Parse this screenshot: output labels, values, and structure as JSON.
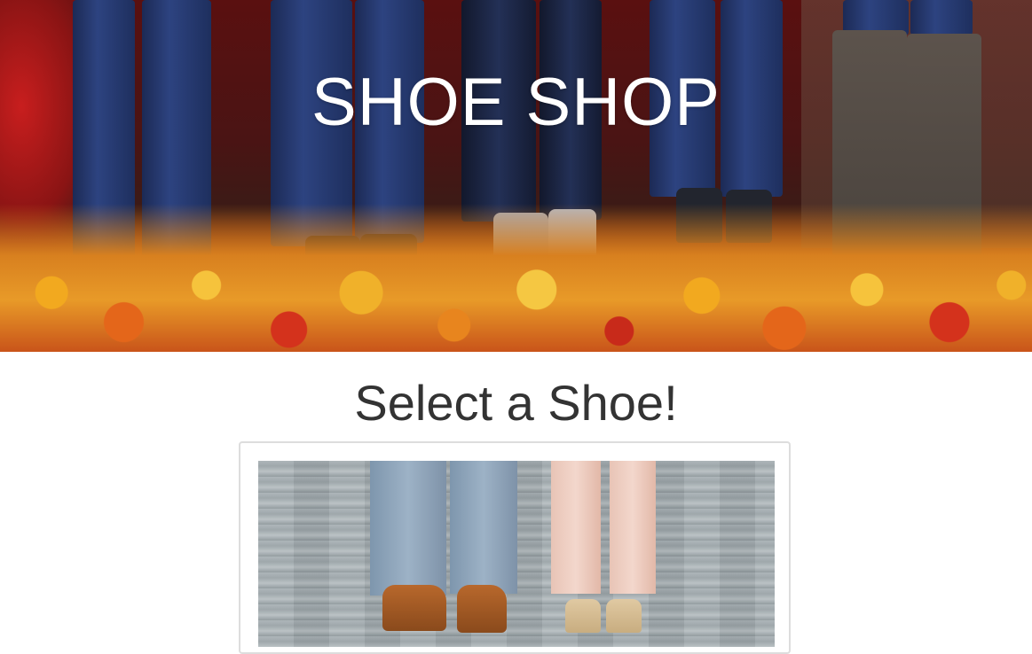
{
  "hero": {
    "title": "SHOE SHOP",
    "image": "people-wearing-shoes-standing-on-autumn-leaves"
  },
  "main": {
    "heading": "Select a Shoe!",
    "card": {
      "image": "two-people-dress-shoes-on-wooden-boardwalk"
    }
  },
  "colors": {
    "title_text": "#ffffff",
    "heading_text": "#333333",
    "card_border": "#dddddd",
    "background": "#ffffff"
  }
}
